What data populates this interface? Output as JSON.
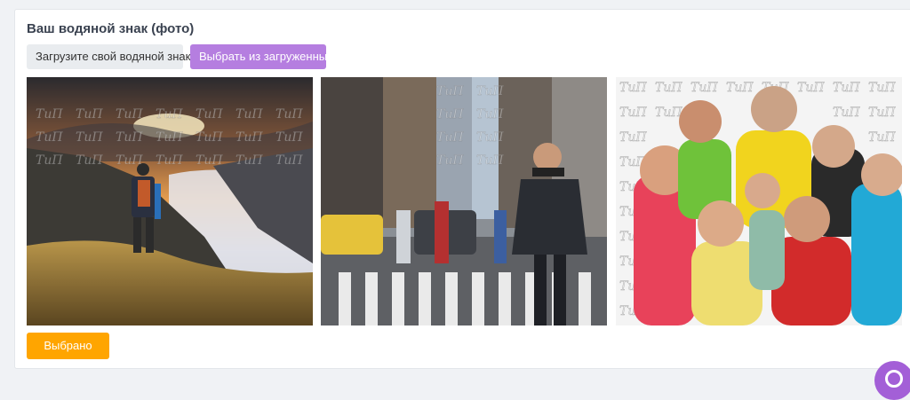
{
  "section": {
    "title": "Ваш водяной знак (фото)"
  },
  "buttons": {
    "upload_label": "Загрузите свой водяной знак",
    "choose_label": "Выбрать из загруженных",
    "selected_label": "Выбрано"
  },
  "watermark_text": "ТиП",
  "colors": {
    "choose_button": "#b57ee0",
    "selected_button": "#ffa500",
    "upload_button": "#e9ecef",
    "fab": "#a35fd7"
  },
  "photos": [
    {
      "subject": "hiker-on-mountain-at-sunset"
    },
    {
      "subject": "businessman-crossing-city-street"
    },
    {
      "subject": "group-of-friends-thumbs-up"
    }
  ]
}
